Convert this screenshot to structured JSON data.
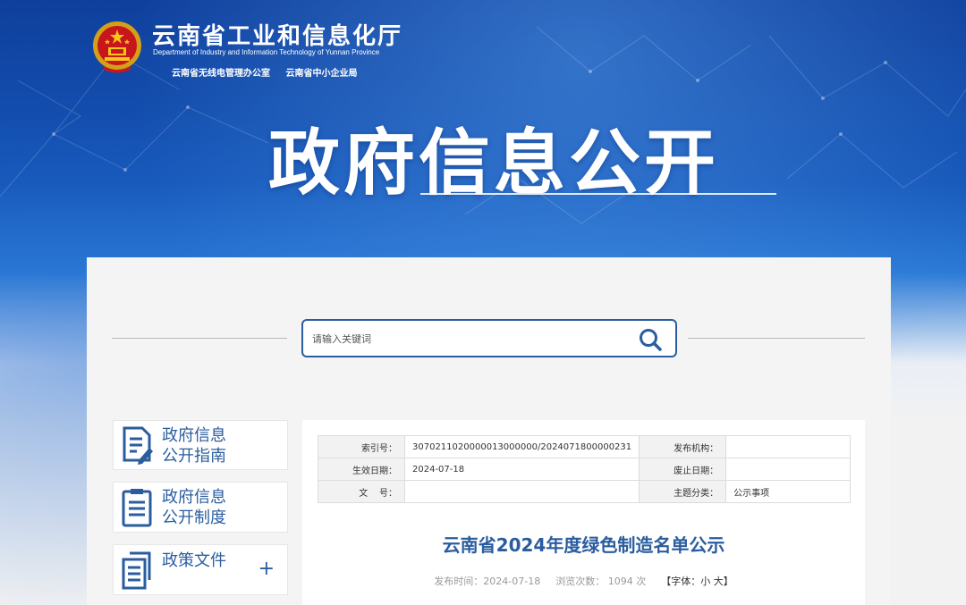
{
  "header": {
    "site_title": "云南省工业和信息化厅",
    "site_subtitle_en": "Department of Industry and Information Technology of Yunnan Province",
    "affiliates": [
      "云南省无线电管理办公室",
      "云南省中小企业局"
    ],
    "banner_title": "政府信息公开"
  },
  "search": {
    "placeholder": "请输入关键词",
    "icon": "search-icon"
  },
  "sidebar": {
    "items": [
      {
        "line1": "政府信息",
        "line2": "公开指南",
        "icon": "document-edit-icon"
      },
      {
        "line1": "政府信息",
        "line2": "公开制度",
        "icon": "clipboard-list-icon"
      },
      {
        "line1": "政策文件",
        "line2": "",
        "icon": "documents-stack-icon",
        "expand": "+"
      }
    ]
  },
  "article": {
    "meta_table": {
      "index_label": "索引号：",
      "index_value": "3070211020000013000000/2024071800000231",
      "publisher_label": "发布机构：",
      "publisher_value": "",
      "effective_label": "生效日期：",
      "effective_value": "2024-07-18",
      "expiry_label": "废止日期：",
      "expiry_value": "",
      "doc_no_label": "文    号：",
      "doc_no_value": "",
      "category_label": "主题分类：",
      "category_value": "公示事项"
    },
    "title": "云南省2024年度绿色制造名单公示",
    "publish_time_label": "发布时间：2024-07-18",
    "views_label": "浏览次数：",
    "views_value": "1094",
    "views_unit": "次",
    "font_label_open": "【字体：",
    "font_small": "小",
    "font_large": "大",
    "font_label_close": "】"
  },
  "colors": {
    "brand_blue": "#2a5d9f",
    "banner_dark": "#0f3f9c"
  }
}
